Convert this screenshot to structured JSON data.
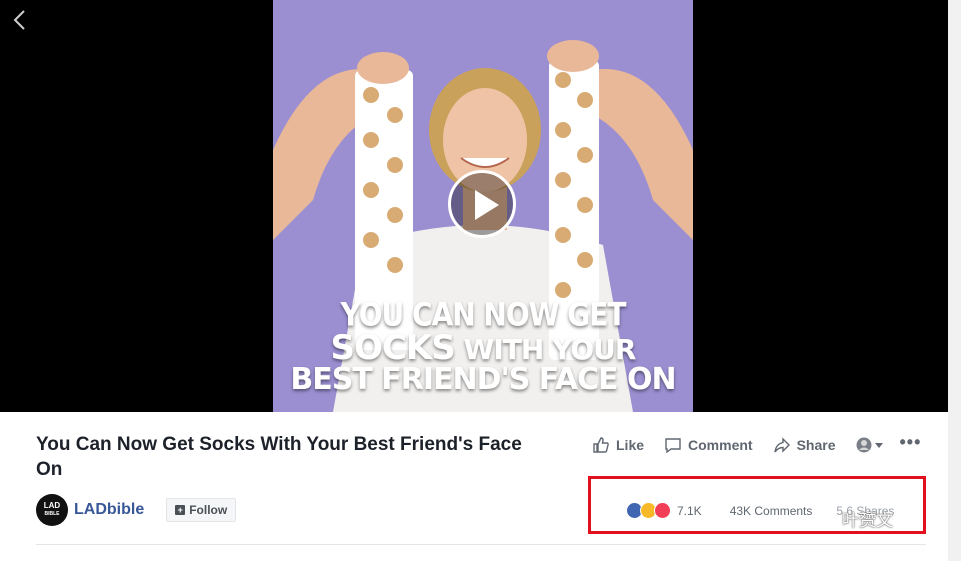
{
  "video": {
    "overlay_line1": "YOU CAN NOW GET",
    "overlay_line2_big": "SOCKS",
    "overlay_line2_small": " WITH YOUR",
    "overlay_line3a": "BEST FRIEND'S ",
    "overlay_line3b": "FACE",
    "overlay_line3c": " ON"
  },
  "post": {
    "title": "You Can Now Get Socks With Your Best Friend's Face On"
  },
  "actions": {
    "like": "Like",
    "comment": "Comment",
    "share": "Share",
    "more": "•••"
  },
  "page": {
    "logo_top": "LAD",
    "logo_bottom": "BIBLE",
    "name": "LADbible",
    "follow": "Follow"
  },
  "stats": {
    "reactions_count": "7.1K",
    "comments": "43K Comments",
    "shares": "5.6 Shares"
  },
  "watermark": {
    "text": "叶赟文"
  },
  "colors": {
    "video_bg": "#9b8fd1",
    "link_blue": "#385898",
    "highlight_red": "#e0101f"
  }
}
